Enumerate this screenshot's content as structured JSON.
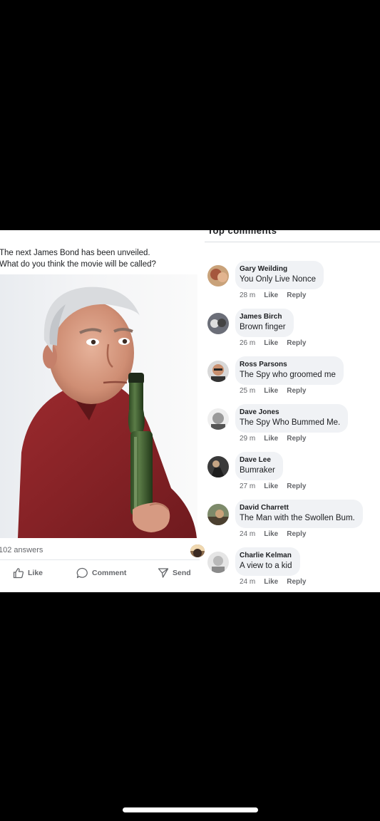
{
  "post": {
    "text_line1": "The next James Bond has been unveiled.",
    "text_line2": "What do you think the movie will be called?",
    "answers": "102 answers",
    "actions": {
      "like": "Like",
      "comment": "Comment",
      "send": "Send"
    }
  },
  "comments_header": "Top comments",
  "comments": [
    {
      "name": "Gary Weilding",
      "text": "You Only Live Nonce",
      "time": "28 m",
      "like": "Like",
      "reply": "Reply"
    },
    {
      "name": "James Birch",
      "text": "Brown finger",
      "time": "26 m",
      "like": "Like",
      "reply": "Reply"
    },
    {
      "name": "Ross Parsons",
      "text": "The Spy who groomed me",
      "time": "25 m",
      "like": "Like",
      "reply": "Reply"
    },
    {
      "name": "Dave Jones",
      "text": "The Spy Who Bummed Me.",
      "time": "29 m",
      "like": "Like",
      "reply": "Reply"
    },
    {
      "name": "Dave Lee",
      "text": "Bumraker",
      "time": "27 m",
      "like": "Like",
      "reply": "Reply"
    },
    {
      "name": "David Charrett",
      "text": "The Man with the Swollen Bum.",
      "time": "24 m",
      "like": "Like",
      "reply": "Reply"
    },
    {
      "name": "Charlie Kelman",
      "text": "A view to a kid",
      "time": "24 m",
      "like": "Like",
      "reply": "Reply"
    }
  ],
  "icons": {
    "like": "thumbs-up-icon",
    "comment": "speech-bubble-icon",
    "send": "paper-plane-icon"
  },
  "colors": {
    "background": "#000000",
    "card": "#ffffff",
    "bubble": "#f0f2f5",
    "meta_text": "#65676b",
    "body_text": "#1c1e21"
  }
}
